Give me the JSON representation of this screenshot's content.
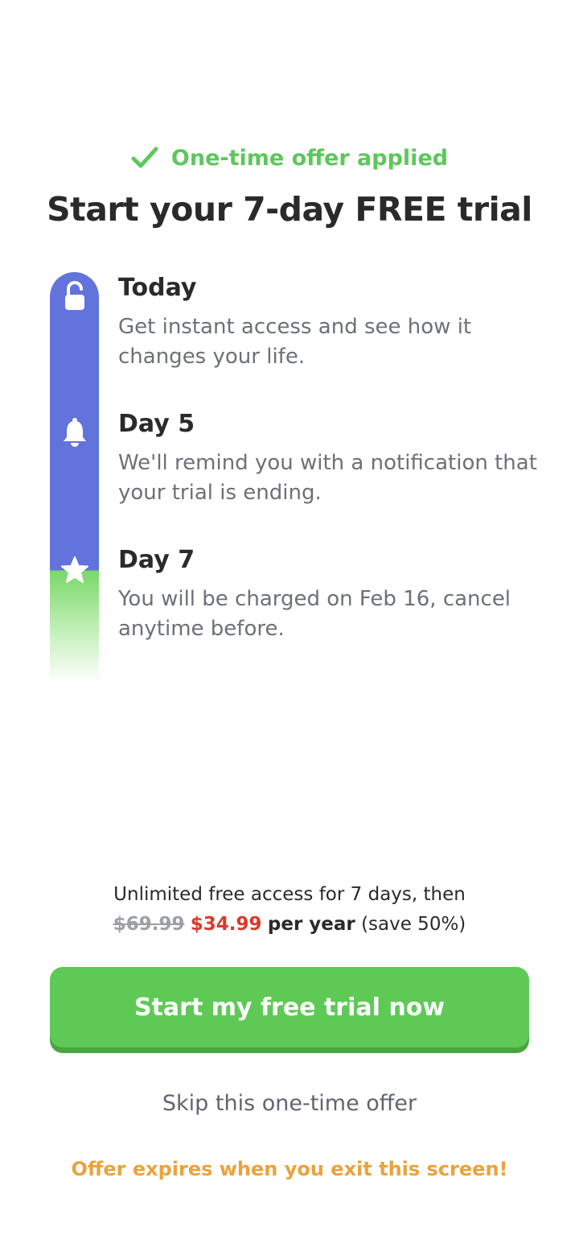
{
  "offer_banner": {
    "label": "One-time offer applied",
    "icon": "check-icon",
    "color": "#5cc85a"
  },
  "headline": "Start your 7-day FREE trial",
  "timeline": {
    "track_color": "#6273dc",
    "end_color": "#7ad86b",
    "steps": [
      {
        "icon": "unlock-icon",
        "title": "Today",
        "description": "Get instant access and see how it changes your life."
      },
      {
        "icon": "bell-icon",
        "title": "Day 5",
        "description": "We'll remind you with a notification that your trial is ending."
      },
      {
        "icon": "star-icon",
        "title": "Day 7",
        "description": "You will be charged on Feb 16, cancel anytime before."
      }
    ]
  },
  "pricing": {
    "intro": "Unlimited free access for 7 days, then",
    "old_price": "$69.99",
    "new_price": "$34.99",
    "period": "per year",
    "savings": "(save 50%)",
    "new_price_color": "#d93a2b"
  },
  "cta": {
    "label": "Start my free trial now",
    "color": "#5fc956"
  },
  "skip_label": "Skip this one-time offer",
  "expiry_notice": {
    "text": "Offer expires when you exit this screen!",
    "color": "#eaa33b"
  }
}
